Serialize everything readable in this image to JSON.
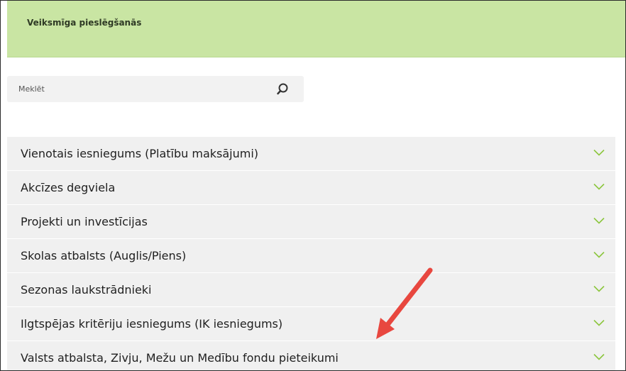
{
  "banner": {
    "message": "Veiksmīga pieslēgšanās",
    "color": "#c9e5a3"
  },
  "search": {
    "placeholder": "Meklēt",
    "value": "",
    "icon": "search-icon"
  },
  "accordion": {
    "chevron_icon": "chevron-down-icon",
    "chevron_color": "#8cc63f",
    "items": [
      {
        "label": "Vienotais iesniegums (Platību maksājumi)"
      },
      {
        "label": "Akcīzes degviela"
      },
      {
        "label": "Projekti un investīcijas"
      },
      {
        "label": "Skolas atbalsts (Auglis/Piens)"
      },
      {
        "label": "Sezonas laukstrādnieki"
      },
      {
        "label": "Ilgtspējas kritēriju iesniegums (IK iesniegums)"
      },
      {
        "label": "Valsts atbalsta, Zivju, Mežu un Medību fondu pieteikumi"
      }
    ]
  },
  "annotation": {
    "icon": "arrow-annotation",
    "color": "#e8473f"
  }
}
